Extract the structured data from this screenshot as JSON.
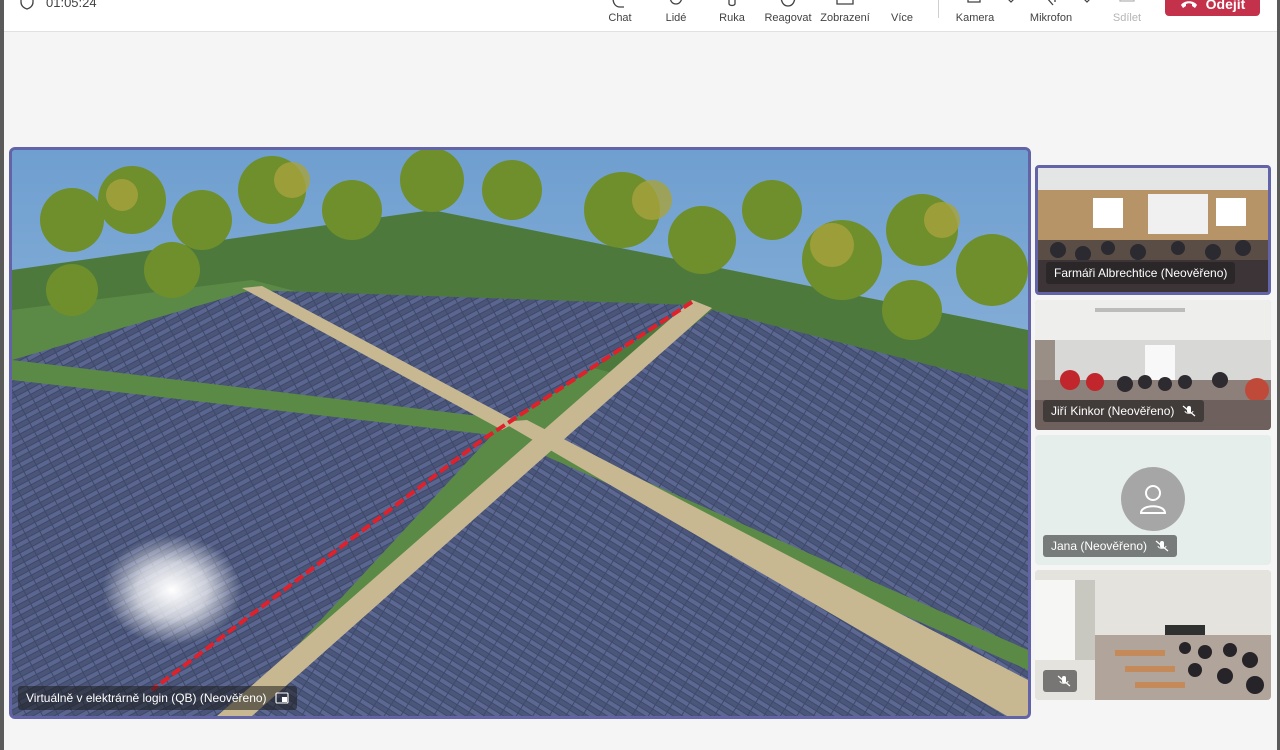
{
  "meeting": {
    "timer": "01:05:24"
  },
  "toolbar": {
    "chat": "Chat",
    "people": "Lidé",
    "hand": "Ruka",
    "react": "Reagovat",
    "view": "Zobrazení",
    "more": "Více",
    "camera": "Kamera",
    "mic": "Mikrofon",
    "share": "Sdílet",
    "leave": "Odejít"
  },
  "stage": {
    "participant": "Virtuálně v elektrárně login (QB) (Neověřeno)"
  },
  "participants": [
    {
      "name": "Farmáři Albrechtice (Neověřeno)",
      "muted": false,
      "active": true
    },
    {
      "name": "Jiří Kinkor (Neověřeno)",
      "muted": true,
      "active": false
    },
    {
      "name": "Jana (Neověřeno)",
      "muted": true,
      "active": false
    },
    {
      "name": "",
      "muted": true,
      "active": false
    }
  ],
  "colors": {
    "accent": "#6264a7",
    "leave": "#c4314b",
    "label_bg": "rgba(30,30,30,0.55)"
  },
  "icons": {
    "timer": "shield-icon",
    "chat": "chat-icon",
    "people": "people-icon",
    "hand": "hand-icon",
    "react": "emoji-icon",
    "view": "view-icon",
    "more": "more-icon",
    "camera": "camera-icon",
    "mic": "mic-icon",
    "share": "share-icon",
    "leave": "phone-hangup-icon",
    "mute": "mic-off-icon",
    "pin": "pin-icon",
    "avatar": "person-icon"
  }
}
